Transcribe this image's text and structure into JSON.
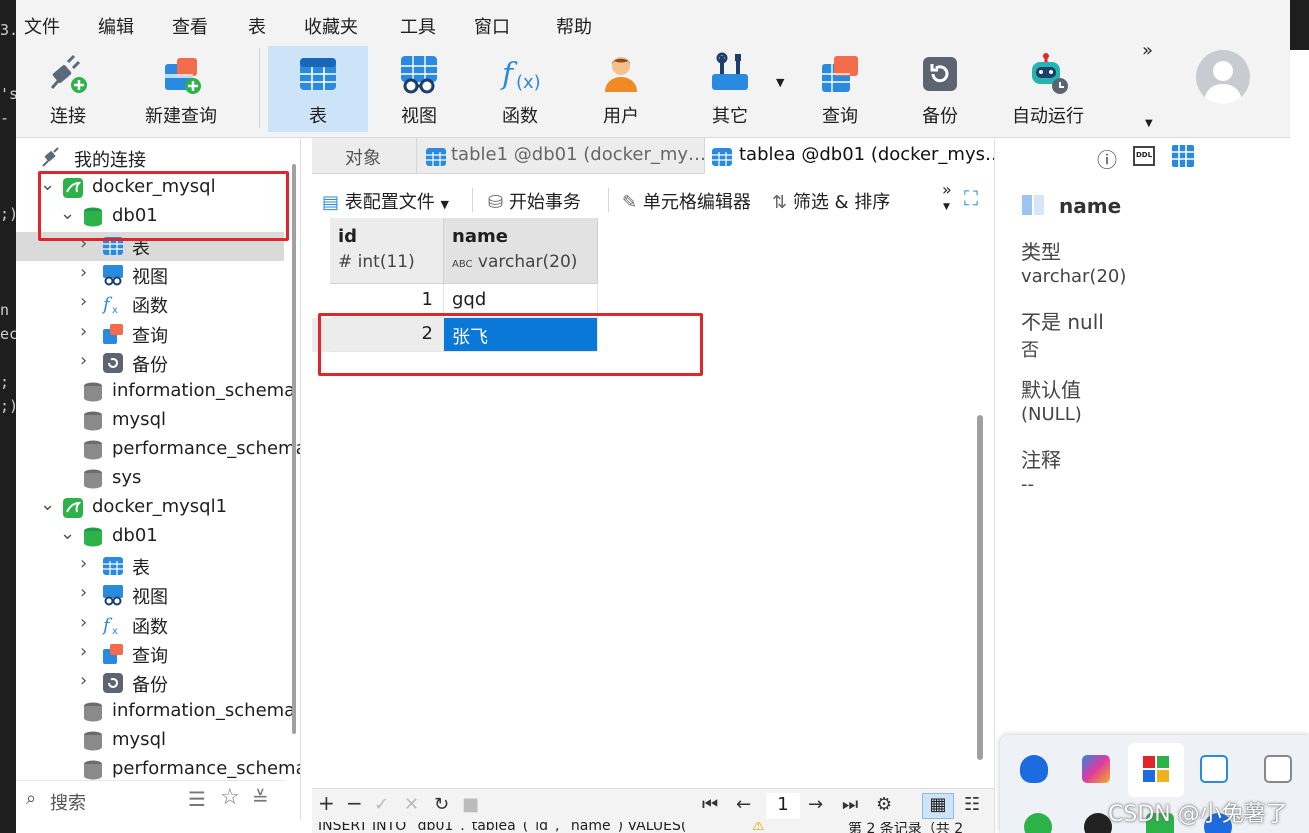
{
  "terminal": {
    "lines": [
      "3.",
      "'s",
      " -",
      ";)",
      "n",
      "ec",
      ";",
      ";)"
    ]
  },
  "menu": [
    "文件",
    "编辑",
    "查看",
    "表",
    "收藏夹",
    "工具",
    "窗口",
    "帮助"
  ],
  "toolbar": {
    "left": [
      {
        "label": "连接",
        "icon": "plug-icon"
      },
      {
        "label": "新建查询",
        "icon": "new-query-icon"
      }
    ],
    "main": [
      {
        "label": "表",
        "icon": "table-icon",
        "active": true
      },
      {
        "label": "视图",
        "icon": "view-icon"
      },
      {
        "label": "函数",
        "icon": "function-icon"
      },
      {
        "label": "用户",
        "icon": "user-icon"
      },
      {
        "label": "其它",
        "icon": "tools-icon"
      },
      {
        "label": "查询",
        "icon": "query-icon"
      },
      {
        "label": "备份",
        "icon": "backup-icon"
      },
      {
        "label": "自动运行",
        "icon": "robot-icon"
      }
    ],
    "overflow": "»"
  },
  "sidebar": {
    "header": "我的连接",
    "tree": [
      {
        "label": "docker_mysql",
        "level": 0,
        "expanded": true,
        "icon": "mysql-connection-icon"
      },
      {
        "label": "db01",
        "level": 1,
        "expanded": true,
        "icon": "database-icon"
      },
      {
        "label": "表",
        "level": 2,
        "expanded": false,
        "icon": "table-icon",
        "selected": true
      },
      {
        "label": "视图",
        "level": 2,
        "expanded": false,
        "icon": "view-icon"
      },
      {
        "label": "函数",
        "level": 2,
        "expanded": false,
        "icon": "function-icon"
      },
      {
        "label": "查询",
        "level": 2,
        "expanded": false,
        "icon": "query-icon"
      },
      {
        "label": "备份",
        "level": 2,
        "expanded": false,
        "icon": "backup-icon"
      },
      {
        "label": "information_schema",
        "level": 1,
        "icon": "database-gray-icon"
      },
      {
        "label": "mysql",
        "level": 1,
        "icon": "database-gray-icon"
      },
      {
        "label": "performance_schema",
        "level": 1,
        "icon": "database-gray-icon"
      },
      {
        "label": "sys",
        "level": 1,
        "icon": "database-gray-icon"
      },
      {
        "label": "docker_mysql1",
        "level": 0,
        "expanded": true,
        "icon": "mysql-connection-icon"
      },
      {
        "label": "db01",
        "level": 1,
        "expanded": true,
        "icon": "database-icon"
      },
      {
        "label": "表",
        "level": 2,
        "expanded": false,
        "icon": "table-icon"
      },
      {
        "label": "视图",
        "level": 2,
        "expanded": false,
        "icon": "view-icon"
      },
      {
        "label": "函数",
        "level": 2,
        "expanded": false,
        "icon": "function-icon"
      },
      {
        "label": "查询",
        "level": 2,
        "expanded": false,
        "icon": "query-icon"
      },
      {
        "label": "备份",
        "level": 2,
        "expanded": false,
        "icon": "backup-icon"
      },
      {
        "label": "information_schema",
        "level": 1,
        "icon": "database-gray-icon"
      },
      {
        "label": "mysql",
        "level": 1,
        "icon": "database-gray-icon"
      },
      {
        "label": "performance_schema",
        "level": 1,
        "icon": "database-gray-icon"
      }
    ],
    "search_placeholder": "搜索"
  },
  "tabs": [
    {
      "label": "对象"
    },
    {
      "label": "table1 @db01 (docker_my…"
    },
    {
      "label": "tablea @db01 (docker_mys…",
      "active": true
    }
  ],
  "subtoolbar": {
    "config": "表配置文件",
    "transaction": "开始事务",
    "cell_editor": "单元格编辑器",
    "filter_sort": "筛选 & 排序"
  },
  "grid": {
    "columns": [
      {
        "name": "id",
        "type": "int(11)",
        "type_icon": "#"
      },
      {
        "name": "name",
        "type": "varchar(20)",
        "type_icon": "ABC"
      }
    ],
    "rows": [
      {
        "id": "1",
        "name": "gqd"
      },
      {
        "id": "2",
        "name": "张飞",
        "selected": true
      }
    ],
    "page": "1"
  },
  "status": {
    "sql": "INSERT INTO `db01`.`tablea`(`id`, `name`) VALUES(",
    "record": "第 2 条记录（共 2"
  },
  "properties": {
    "field_name": "name",
    "fields": [
      {
        "label": "类型",
        "value": "varchar(20)"
      },
      {
        "label": "不是 null",
        "value": "否"
      },
      {
        "label": "默认值",
        "value": "(NULL)"
      },
      {
        "label": "注释",
        "value": "--"
      }
    ]
  },
  "watermark": "CSDN @小兔薯了",
  "colors": {
    "accent": "#0a78d7",
    "highlight_red": "#e0252b",
    "selection": "#0a78d7",
    "toolbar_bg": "#f3f3f3"
  }
}
